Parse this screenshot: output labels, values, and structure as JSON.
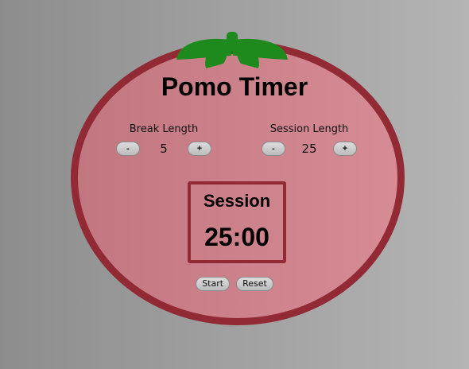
{
  "title": "Pomo Timer",
  "break": {
    "label": "Break Length",
    "decrement_label": "-",
    "value": "5",
    "increment_label": "+"
  },
  "session": {
    "label": "Session Length",
    "decrement_label": "-",
    "value": "25",
    "increment_label": "+"
  },
  "timer": {
    "label": "Session",
    "time": "25:00"
  },
  "actions": {
    "start_label": "Start",
    "reset_label": "Reset"
  },
  "colors": {
    "background_left": "#8d8d8d",
    "background_right": "#b4b4b4",
    "tomato_fill": "#d08890",
    "tomato_border": "#922a35",
    "stem": "#1e8a1e",
    "timer_border": "#922a35"
  },
  "icons": {
    "stem": "tomato-stem-icon"
  }
}
